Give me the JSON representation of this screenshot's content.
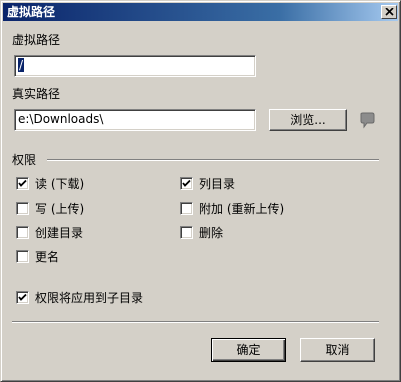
{
  "window": {
    "title": "虚拟路径",
    "close_label": "x"
  },
  "virtual_path": {
    "label": "虚拟路径",
    "value": "/"
  },
  "real_path": {
    "label": "真实路径",
    "value": "e:\\Downloads\\",
    "browse_label": "浏览..."
  },
  "permissions": {
    "group_label": "权限",
    "items": [
      {
        "label": "读 (下载)",
        "checked": true
      },
      {
        "label": "写 (上传)",
        "checked": false
      },
      {
        "label": "创建目录",
        "checked": false
      },
      {
        "label": "更名",
        "checked": false
      },
      {
        "label": "列目录",
        "checked": true
      },
      {
        "label": "附加 (重新上传)",
        "checked": false
      },
      {
        "label": "删除",
        "checked": false
      }
    ],
    "apply_subdirs": {
      "label": "权限将应用到子目录",
      "checked": true
    }
  },
  "buttons": {
    "ok_label": "确定",
    "cancel_label": "取消"
  },
  "icons": {
    "close": "close-icon",
    "check": "checkmark-icon",
    "side": "speech-bubble-icon"
  }
}
